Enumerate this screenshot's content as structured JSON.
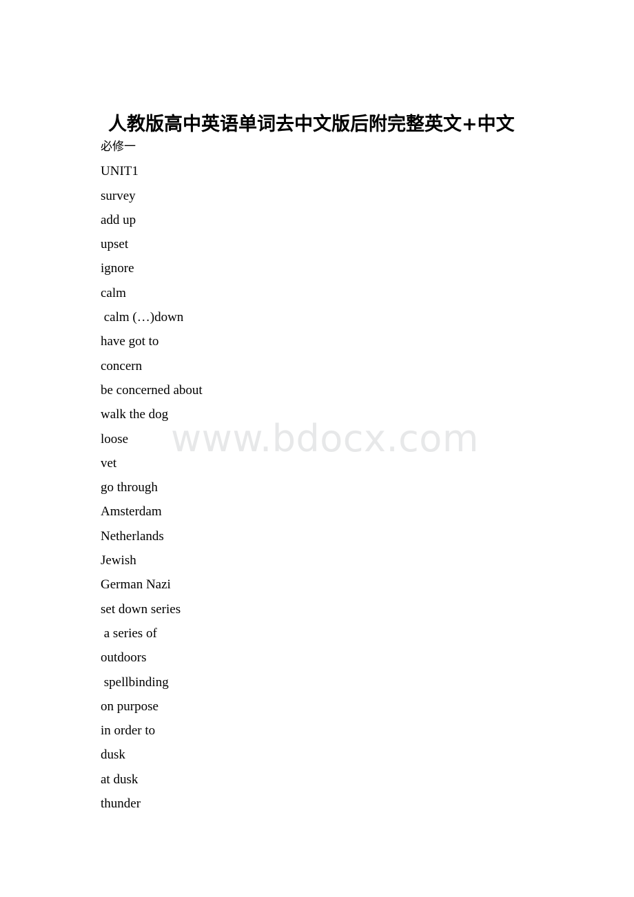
{
  "document": {
    "title": "人教版高中英语单词去中文版后附完整英文+中文",
    "watermark": "www.bdocx.com",
    "lines": [
      {
        "text": "必修一",
        "script": "cjk",
        "indented": false
      },
      {
        "text": "UNIT1",
        "script": "latin",
        "indented": false
      },
      {
        "text": "survey",
        "script": "latin",
        "indented": false
      },
      {
        "text": "add up",
        "script": "latin",
        "indented": false
      },
      {
        "text": "upset",
        "script": "latin",
        "indented": false
      },
      {
        "text": "ignore",
        "script": "latin",
        "indented": false
      },
      {
        "text": "calm",
        "script": "latin",
        "indented": false
      },
      {
        "text": " calm (…)down",
        "script": "latin",
        "indented": true
      },
      {
        "text": "have got to",
        "script": "latin",
        "indented": false
      },
      {
        "text": "concern",
        "script": "latin",
        "indented": false
      },
      {
        "text": "be concerned about",
        "script": "latin",
        "indented": false
      },
      {
        "text": "walk the dog",
        "script": "latin",
        "indented": false
      },
      {
        "text": "loose",
        "script": "latin",
        "indented": false
      },
      {
        "text": "vet",
        "script": "latin",
        "indented": false
      },
      {
        "text": "go through",
        "script": "latin",
        "indented": false
      },
      {
        "text": "Amsterdam",
        "script": "latin",
        "indented": false
      },
      {
        "text": "Netherlands",
        "script": "latin",
        "indented": false
      },
      {
        "text": "Jewish",
        "script": "latin",
        "indented": false
      },
      {
        "text": "German Nazi",
        "script": "latin",
        "indented": false
      },
      {
        "text": "set down series",
        "script": "latin",
        "indented": false
      },
      {
        "text": " a series of",
        "script": "latin",
        "indented": true
      },
      {
        "text": "outdoors",
        "script": "latin",
        "indented": false
      },
      {
        "text": " spellbinding",
        "script": "latin",
        "indented": true
      },
      {
        "text": "on purpose",
        "script": "latin",
        "indented": false
      },
      {
        "text": "in order to",
        "script": "latin",
        "indented": false
      },
      {
        "text": "dusk",
        "script": "latin",
        "indented": false
      },
      {
        "text": "at dusk",
        "script": "latin",
        "indented": false
      },
      {
        "text": "thunder",
        "script": "latin",
        "indented": false
      }
    ]
  },
  "colors": {
    "page_background": "#ffffff",
    "text": "#000000",
    "watermark": "#e7e8e9"
  }
}
